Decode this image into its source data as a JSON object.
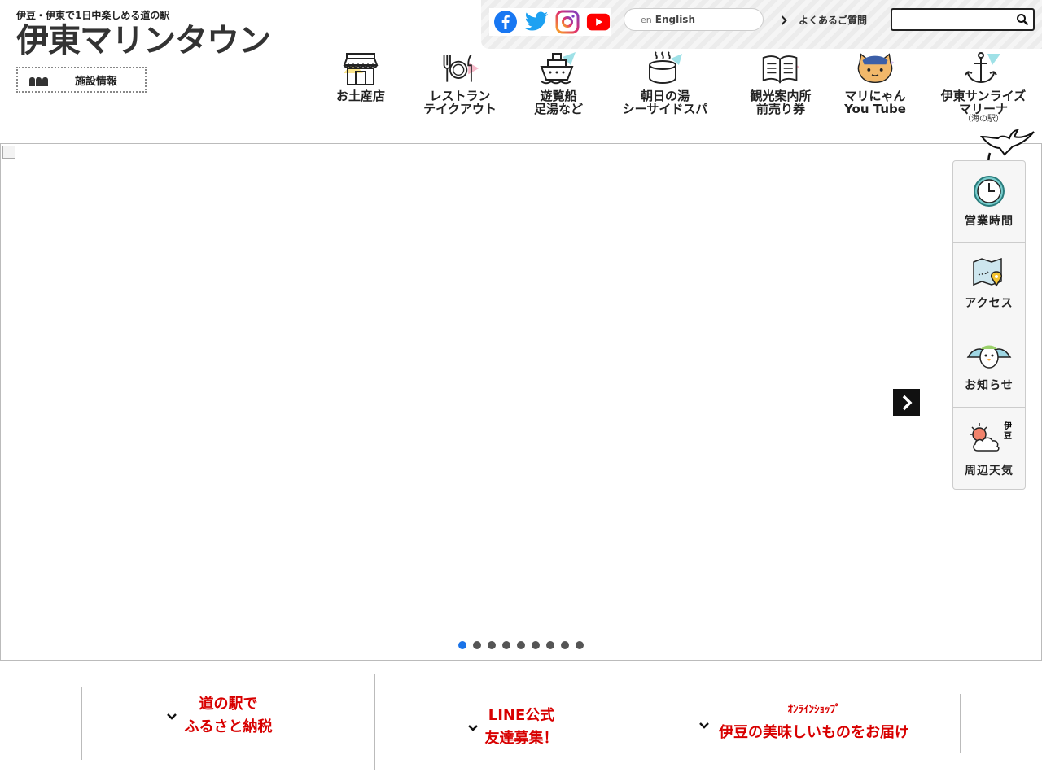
{
  "header": {
    "tagline": "伊豆・伊東で1日中楽しめる道の駅",
    "site_title": "伊東マリンタウン",
    "facility_button": "施設情報"
  },
  "topbar": {
    "social": [
      "facebook-icon",
      "twitter-icon",
      "instagram-icon",
      "youtube-icon"
    ],
    "language_flag_alt": "en",
    "language_label": "English",
    "faq_label": "よくあるご質問",
    "search_placeholder": ""
  },
  "nav": {
    "items": [
      {
        "label": "お土産店",
        "icon": "shop-icon"
      },
      {
        "label": "レストラン\nテイクアウト",
        "icon": "restaurant-icon"
      },
      {
        "label": "遊覧船\n足湯など",
        "icon": "ship-icon"
      },
      {
        "label": "朝日の湯\nシーサイドスパ",
        "icon": "onsen-icon"
      },
      {
        "label": "観光案内所\n前売り券",
        "icon": "book-icon"
      },
      {
        "label": "マリにゃん\nYou Tube",
        "icon": "cat-mascot-icon"
      },
      {
        "label": "伊東サンライズ\nマリーナ",
        "sub": "（海の駅）",
        "icon": "anchor-icon"
      }
    ]
  },
  "slider": {
    "dot_count": 9,
    "active_dot": 0
  },
  "sidepanel": {
    "items": [
      {
        "label": "営業時間",
        "icon": "clock-icon"
      },
      {
        "label": "アクセス",
        "icon": "map-icon"
      },
      {
        "label": "お知らせ",
        "icon": "seagull-icon"
      },
      {
        "label": "周辺天気",
        "icon": "weather-icon",
        "badge": "伊\n豆"
      }
    ]
  },
  "banners": {
    "furusato": "道の駅で\nふるさと納税",
    "line": "LINE公式\n友達募集！",
    "shop_small": "ｵﾝﾗｲﾝｼｮｯﾌﾟ",
    "shop_main": "伊豆の美味しいものをお届け"
  },
  "colors": {
    "accent_red": "#d80000",
    "active_dot": "#1a73e8",
    "facebook": "#1877f2",
    "twitter": "#1da1f2",
    "youtube": "#ff0000"
  }
}
